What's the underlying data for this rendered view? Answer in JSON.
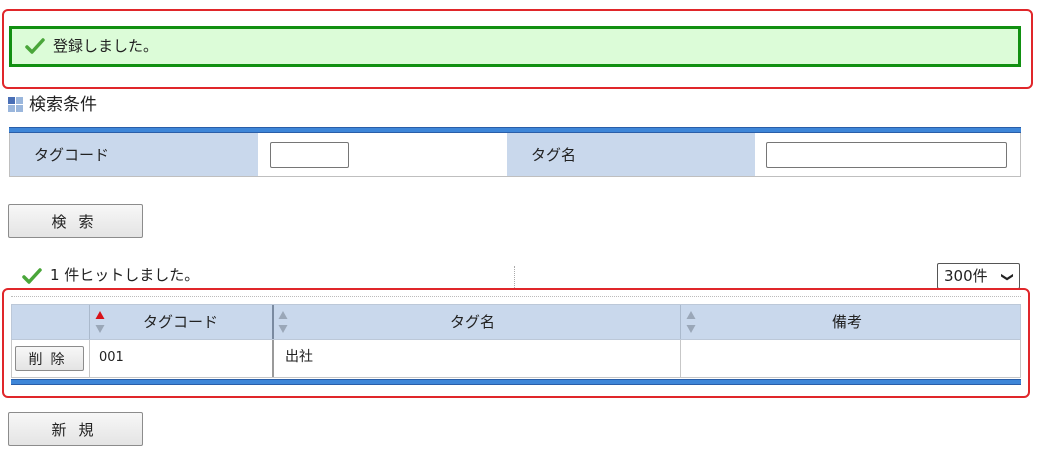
{
  "message": {
    "text": "登録しました。",
    "icon": "checkmark-icon",
    "color": "#119011"
  },
  "section": {
    "title": "検索条件",
    "icon": "grid-icon"
  },
  "search": {
    "tag_code_label": "タグコード",
    "tag_code_value": "",
    "tag_name_label": "タグ名",
    "tag_name_value": "",
    "search_button": "検索"
  },
  "results": {
    "hit_text": "1 件ヒットしました。",
    "per_page": "300件",
    "columns": [
      "タグコード",
      "タグ名",
      "備考"
    ],
    "rows": [
      {
        "delete_label": "削除",
        "tag_code": "001",
        "tag_name": "出社",
        "note": ""
      }
    ],
    "sort_active": "タグコード"
  },
  "new_button": "新規",
  "colors": {
    "header_bg": "#c9d8ec",
    "accent_bar": "#3e86d8",
    "alert_border": "#e0262a",
    "success_bg": "#dcfcd8"
  }
}
